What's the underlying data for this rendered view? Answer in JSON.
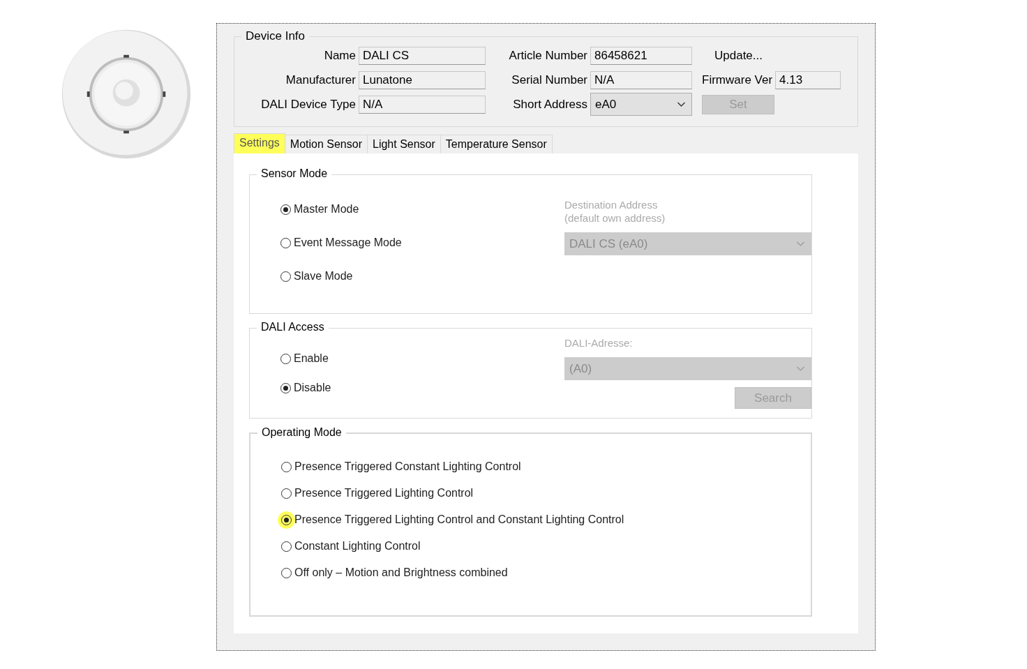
{
  "device_info": {
    "title": "Device Info",
    "cells": [
      {
        "kind": "field",
        "label": "Name",
        "value": "DALI CS"
      },
      {
        "kind": "field",
        "label": "Article Number",
        "value": "86458621"
      },
      {
        "kind": "link",
        "label": "Update..."
      },
      {
        "kind": "field",
        "label": "Manufacturer",
        "value": "Lunatone"
      },
      {
        "kind": "field",
        "label": "Serial Number",
        "value": "N/A"
      },
      {
        "kind": "field",
        "label": "Firmware Ver",
        "value": "4.13"
      },
      {
        "kind": "field",
        "label": "DALI Device Type",
        "value": "N/A"
      },
      {
        "kind": "dropdown",
        "label": "Short Address",
        "value": "eA0"
      },
      {
        "kind": "button",
        "label": "Set",
        "disabled": true
      }
    ]
  },
  "tabs": [
    {
      "label": "Settings",
      "selected": true,
      "highlighted": true
    },
    {
      "label": "Motion Sensor",
      "selected": false,
      "highlighted": false
    },
    {
      "label": "Light Sensor",
      "selected": false,
      "highlighted": false
    },
    {
      "label": "Temperature Sensor",
      "selected": false,
      "highlighted": false
    }
  ],
  "sensor_mode": {
    "title": "Sensor Mode",
    "options": [
      {
        "label": "Master Mode",
        "selected": true
      },
      {
        "label": "Event Message Mode",
        "selected": false
      },
      {
        "label": "Slave Mode",
        "selected": false
      }
    ],
    "destination_label": [
      "Destination Address",
      "(default own address)"
    ],
    "destination": {
      "value": "DALI CS (eA0)",
      "disabled": true
    }
  },
  "dali_access": {
    "title": "DALI Access",
    "options": [
      {
        "label": "Enable",
        "selected": false
      },
      {
        "label": "Disable",
        "selected": true
      }
    ],
    "address_label": "DALI-Adresse:",
    "address": {
      "value": "(A0)",
      "disabled": true
    },
    "search_button": {
      "label": "Search",
      "disabled": true
    }
  },
  "operating_mode": {
    "title": "Operating Mode",
    "options": [
      {
        "label": "Presence Triggered Constant Lighting Control",
        "selected": false,
        "highlighted": false
      },
      {
        "label": "Presence Triggered Lighting Control",
        "selected": false,
        "highlighted": false
      },
      {
        "label": "Presence Triggered Lighting Control and Constant Lighting Control",
        "selected": true,
        "highlighted": true
      },
      {
        "label": "Constant Lighting Control",
        "selected": false,
        "highlighted": false
      },
      {
        "label": "Off only – Motion and Brightness combined",
        "selected": false,
        "highlighted": false
      }
    ]
  }
}
